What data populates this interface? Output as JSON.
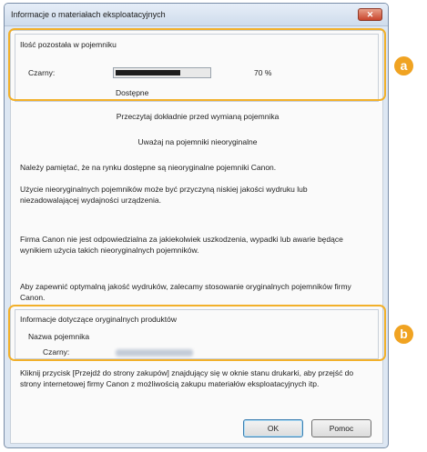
{
  "window": {
    "title": "Informacje o materiałach eksploatacyjnych",
    "close_label": "✕"
  },
  "remaining": {
    "group_title": "Ilość pozostała w pojemniku",
    "color_label": "Czarny:",
    "percent_text": "70 %",
    "level_fraction": 0.7,
    "status": "Dostępne"
  },
  "notices": {
    "read_before": "Przeczytaj dokładnie przed wymianą pojemnika",
    "warning_heading": "Uważaj na pojemniki nieoryginalne",
    "p1": "Należy pamiętać, że na rynku dostępne są nieoryginalne pojemniki Canon.",
    "p2": "Użycie nieoryginalnych pojemników może być przyczyną niskiej jakości wydruku lub niezadowalającej wydajności urządzenia.",
    "p3": "Firma Canon nie jest odpowiedzialna za jakiekolwiek uszkodzenia, wypadki lub awarie będące wynikiem użycia takich nieoryginalnych pojemników.",
    "p4": "Aby zapewnić optymalną jakość wydruków, zalecamy stosowanie oryginalnych pojemników firmy Canon."
  },
  "product_info": {
    "group_title": "Informacje dotyczące oryginalnych produktów",
    "name_label": "Nazwa pojemnika",
    "color_label": "Czarny:"
  },
  "footer_text": "Kliknij przycisk [Przejdź do strony zakupów] znajdujący się w oknie stanu drukarki, aby przejść do strony internetowej firmy Canon z możliwością zakupu materiałów eksploatacyjnych itp.",
  "buttons": {
    "ok": "OK",
    "help": "Pomoc"
  },
  "callouts": {
    "a": "a",
    "b": "b"
  },
  "colors": {
    "highlight": "#f2b02a",
    "callout": "#f0a322",
    "toner": "#1e1e1e"
  }
}
